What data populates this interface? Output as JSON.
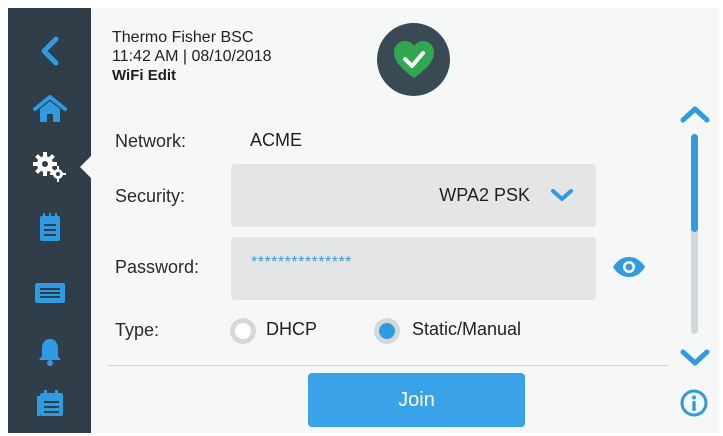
{
  "header": {
    "device_name": "Thermo Fisher BSC",
    "datetime": "11:42 AM | 08/10/2018",
    "screen_title": "WiFi Edit"
  },
  "status": {
    "icon": "shield-check-icon",
    "color": "#2fa84f"
  },
  "sidebar": {
    "items": [
      {
        "icon": "back-arrow-icon"
      },
      {
        "icon": "home-icon"
      },
      {
        "icon": "settings-gears-icon",
        "active": true
      },
      {
        "icon": "notepad-icon"
      },
      {
        "icon": "display-screen-icon"
      },
      {
        "icon": "bell-icon"
      },
      {
        "icon": "calendar-list-icon"
      }
    ]
  },
  "form": {
    "network_label": "Network:",
    "network_value": "ACME",
    "security_label": "Security:",
    "security_value": "WPA2 PSK",
    "password_label": "Password:",
    "password_value": "***************",
    "type_label": "Type:",
    "type_options": [
      {
        "label": "DHCP",
        "selected": false
      },
      {
        "label": "Static/Manual",
        "selected": true
      }
    ]
  },
  "actions": {
    "join_label": "Join"
  },
  "colors": {
    "accent": "#2f9be3",
    "sidebar": "#2f3e48",
    "field_bg": "#e3e6e5"
  }
}
